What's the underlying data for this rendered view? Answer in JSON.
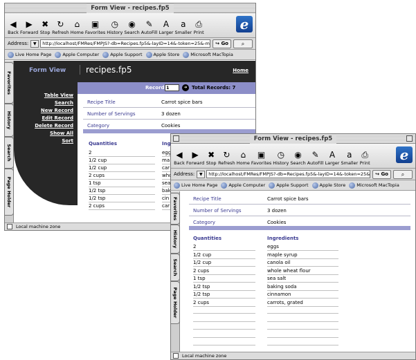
{
  "title": "Form View - recipes.fp5",
  "toolbar": [
    {
      "label": "Back",
      "icon": "back-arrow-icon",
      "glyph": "◀"
    },
    {
      "label": "Forward",
      "icon": "forward-arrow-icon",
      "glyph": "▶"
    },
    {
      "label": "Stop",
      "icon": "stop-icon",
      "glyph": "✖"
    },
    {
      "label": "Refresh",
      "icon": "refresh-icon",
      "glyph": "↻"
    },
    {
      "label": "Home",
      "icon": "home-icon",
      "glyph": "⌂"
    },
    {
      "label": "Favorites",
      "icon": "favorites-icon",
      "glyph": "▣"
    },
    {
      "label": "History",
      "icon": "history-icon",
      "glyph": "◷"
    },
    {
      "label": "Search",
      "icon": "search-icon",
      "glyph": "◉"
    },
    {
      "label": "AutoFill",
      "icon": "autofill-icon",
      "glyph": "✎"
    },
    {
      "label": "Larger",
      "icon": "larger-text-icon",
      "glyph": "A"
    },
    {
      "label": "Smaller",
      "icon": "smaller-text-icon",
      "glyph": "a"
    },
    {
      "label": "Print",
      "icon": "print-icon",
      "glyph": "⎙"
    }
  ],
  "address": {
    "label": "Address:",
    "url": "http://localhost/FMRes/FMPJS?-db=Recipes.fp5&-layID=14&-token=25&-max=",
    "go_label": "Go"
  },
  "favorites": [
    "Live Home Page",
    "Apple Computer",
    "Apple Support",
    "Apple Store",
    "Microsoft MacTopia"
  ],
  "side_tabs": [
    "Favorites",
    "History",
    "Search",
    "Page Holder"
  ],
  "status": "Local machine zone",
  "fm": {
    "view_label": "Form View",
    "file_name": "recipes.fp5",
    "home_link": "Home",
    "nav_links": [
      "Table View",
      "Search",
      "New Record",
      "Edit Record",
      "Delete Record",
      "Show All",
      "Sort"
    ],
    "record_label": "Record",
    "record_number": "1",
    "total_records": "Total Records: 7"
  },
  "record": {
    "fields": [
      {
        "label": "Recipe Title",
        "value": "Carrot spice bars"
      },
      {
        "label": "Number of Servings",
        "value": "3 dozen"
      },
      {
        "label": "Category",
        "value": "Cookies"
      }
    ],
    "quantities_header": "Quantities",
    "ingredients_header": "Ingredients",
    "items": [
      {
        "qty": "2",
        "ingredient": "eggs"
      },
      {
        "qty": "1/2 cup",
        "ingredient": "maple syrup"
      },
      {
        "qty": "1/2 cup",
        "ingredient": "canola oil"
      },
      {
        "qty": "2 cups",
        "ingredient": "whole wheat flour"
      },
      {
        "qty": "1 tsp",
        "ingredient": "sea salt"
      },
      {
        "qty": "1/2 tsp",
        "ingredient": "baking soda"
      },
      {
        "qty": "1/2 tsp",
        "ingredient": "cinnamon"
      },
      {
        "qty": "2 cups",
        "ingredient": "carrots, grated"
      }
    ]
  },
  "back_visible_ingredients": [
    "egg",
    "ma",
    "car",
    "who",
    "sea",
    "bak",
    "cin",
    "car"
  ],
  "back_ingredients_header": "Ing"
}
